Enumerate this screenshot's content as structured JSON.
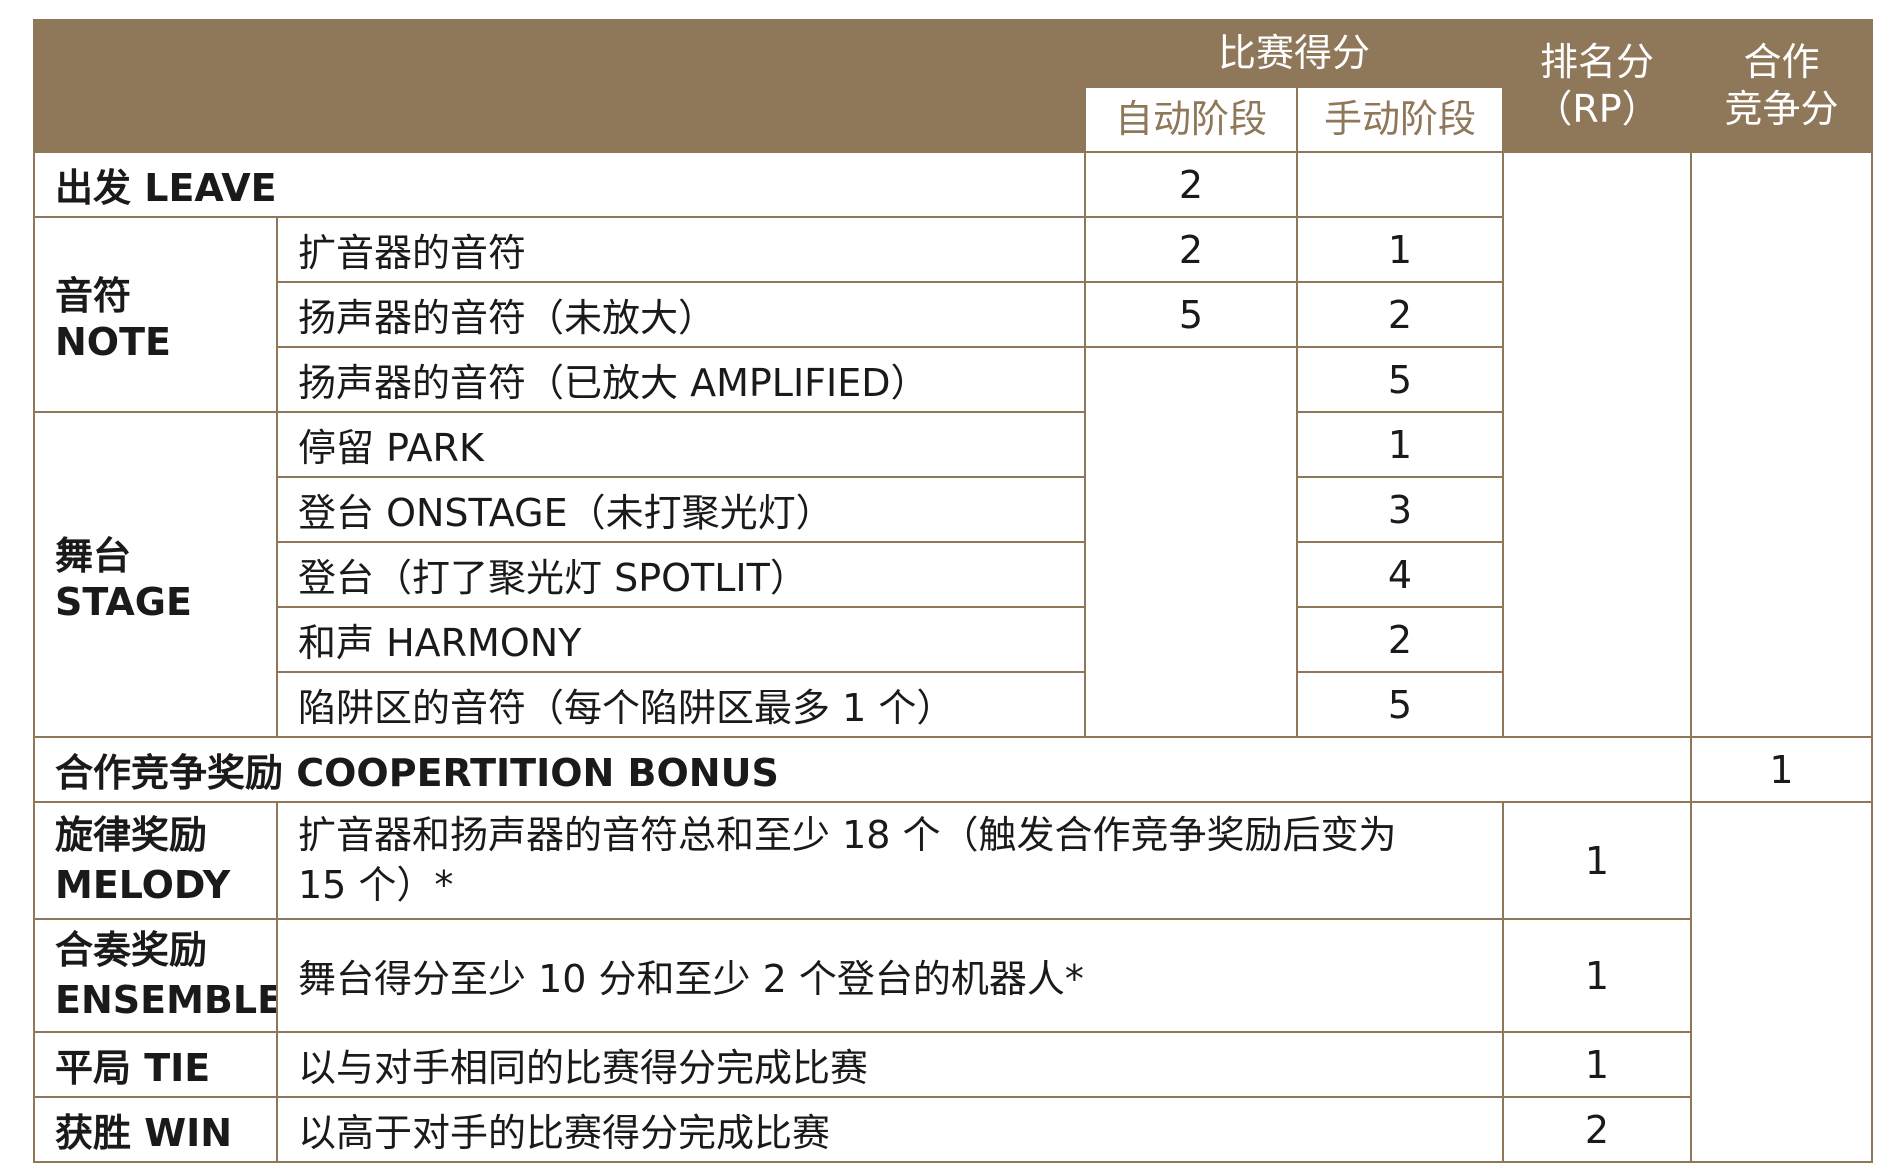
{
  "header": {
    "match_points": "比赛得分",
    "auto": "自动阶段",
    "teleop": "手动阶段",
    "rp_line1": "排名分",
    "rp_line2": "（RP）",
    "coop_line1": "合作",
    "coop_line2": "竞争分"
  },
  "leave": {
    "label": "出发 LEAVE",
    "auto": "2"
  },
  "note": {
    "label": "音符 NOTE",
    "rows": [
      {
        "desc": "扩音器的音符",
        "auto": "2",
        "teleop": "1"
      },
      {
        "desc": "扬声器的音符（未放大）",
        "auto": "5",
        "teleop": "2"
      },
      {
        "desc": "扬声器的音符（已放大 AMPLIFIED）",
        "teleop": "5"
      }
    ]
  },
  "stage": {
    "label_line1": "舞台",
    "label_line2": "STAGE",
    "rows": [
      {
        "desc": "停留 PARK",
        "teleop": "1"
      },
      {
        "desc": "登台 ONSTAGE（未打聚光灯）",
        "teleop": "3"
      },
      {
        "desc": "登台（打了聚光灯 SPOTLIT）",
        "teleop": "4"
      },
      {
        "desc": "和声 HARMONY",
        "teleop": "2"
      },
      {
        "desc": "陷阱区的音符（每个陷阱区最多 1 个）",
        "teleop": "5"
      }
    ]
  },
  "coopertition": {
    "label": "合作竞争奖励 COOPERTITION BONUS",
    "coop": "1"
  },
  "melody": {
    "label_line1": "旋律奖励",
    "label_line2": "MELODY",
    "desc_line1": "扩音器和扬声器的音符总和至少 18 个（触发合作竞争奖励后变为",
    "desc_line2": "15 个）*",
    "rp": "1"
  },
  "ensemble": {
    "label_line1": "合奏奖励",
    "label_line2": "ENSEMBLE",
    "desc": "舞台得分至少 10 分和至少 2 个登台的机器人*",
    "rp": "1"
  },
  "tie": {
    "label": "平局 TIE",
    "desc": "以与对手相同的比赛得分完成比赛",
    "rp": "1"
  },
  "win": {
    "label": "获胜 WIN",
    "desc": "以高于对手的比赛得分完成比赛",
    "rp": "2"
  },
  "colors": {
    "header_bg": "#8f7759",
    "header_text": "#ffffff",
    "border": "#8f7759"
  }
}
